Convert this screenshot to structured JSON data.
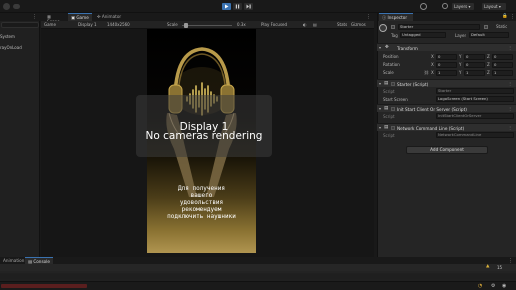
{
  "toolbar": {
    "layers_label": "Layers",
    "layout_label": "Layout"
  },
  "hierarchy": {
    "items": [
      {
        "label": "System"
      },
      {
        "label": "rayOnLoad"
      }
    ]
  },
  "tabs": [
    {
      "label": "Scene"
    },
    {
      "label": "Game"
    },
    {
      "label": "Animator"
    }
  ],
  "game_toolbar": {
    "mode": "Game",
    "display": "Display 1",
    "resolution": "1440x2560",
    "scale_label": "Scale",
    "scale_value": "0.3x",
    "play_mode": "Play Focused",
    "stats_label": "Stats",
    "gizmos_label": "Gizmos"
  },
  "game_view": {
    "display_line1": "Display 1",
    "display_line2": "No cameras rendering",
    "phone_text": [
      "Для получения",
      "вашего",
      "удовольствия",
      "рекомендуем",
      "подключить наушники"
    ]
  },
  "inspector": {
    "tab_label": "Inspector",
    "object_name": "Starter",
    "static_label": "Static",
    "tag_label": "Tag",
    "tag_value": "Untagged",
    "layer_label": "Layer",
    "layer_value": "Default",
    "transform_title": "Transform",
    "position_label": "Position",
    "rotation_label": "Rotation",
    "scale_label": "Scale",
    "x_label": "X",
    "y_label": "Y",
    "z_label": "Z",
    "position": [
      "0",
      "0",
      "0"
    ],
    "rotation": [
      "0",
      "0",
      "0"
    ],
    "scale": [
      "1",
      "1",
      "1"
    ],
    "starter_script_title": "Starter (Script)",
    "script_label": "Script",
    "starter_script_value": "Starter",
    "start_screen_label": "Start Screen",
    "start_screen_value": "LogoScreen (Start Screen)",
    "init_client_title": "Init Start Client Or Server (Script)",
    "init_client_value": "InitStartClientOrServer",
    "network_cmd_title": "Network Command Line (Script)",
    "network_cmd_value": "NetworkCommandLine",
    "add_component_label": "Add Component"
  },
  "bottom": {
    "tab_animation": "Animation",
    "tab_console": "Console",
    "count_label": "15"
  },
  "colors": {
    "accent_blue": "#3a72b0",
    "gold": "#c9a84c",
    "error_red": "#c0392b"
  }
}
